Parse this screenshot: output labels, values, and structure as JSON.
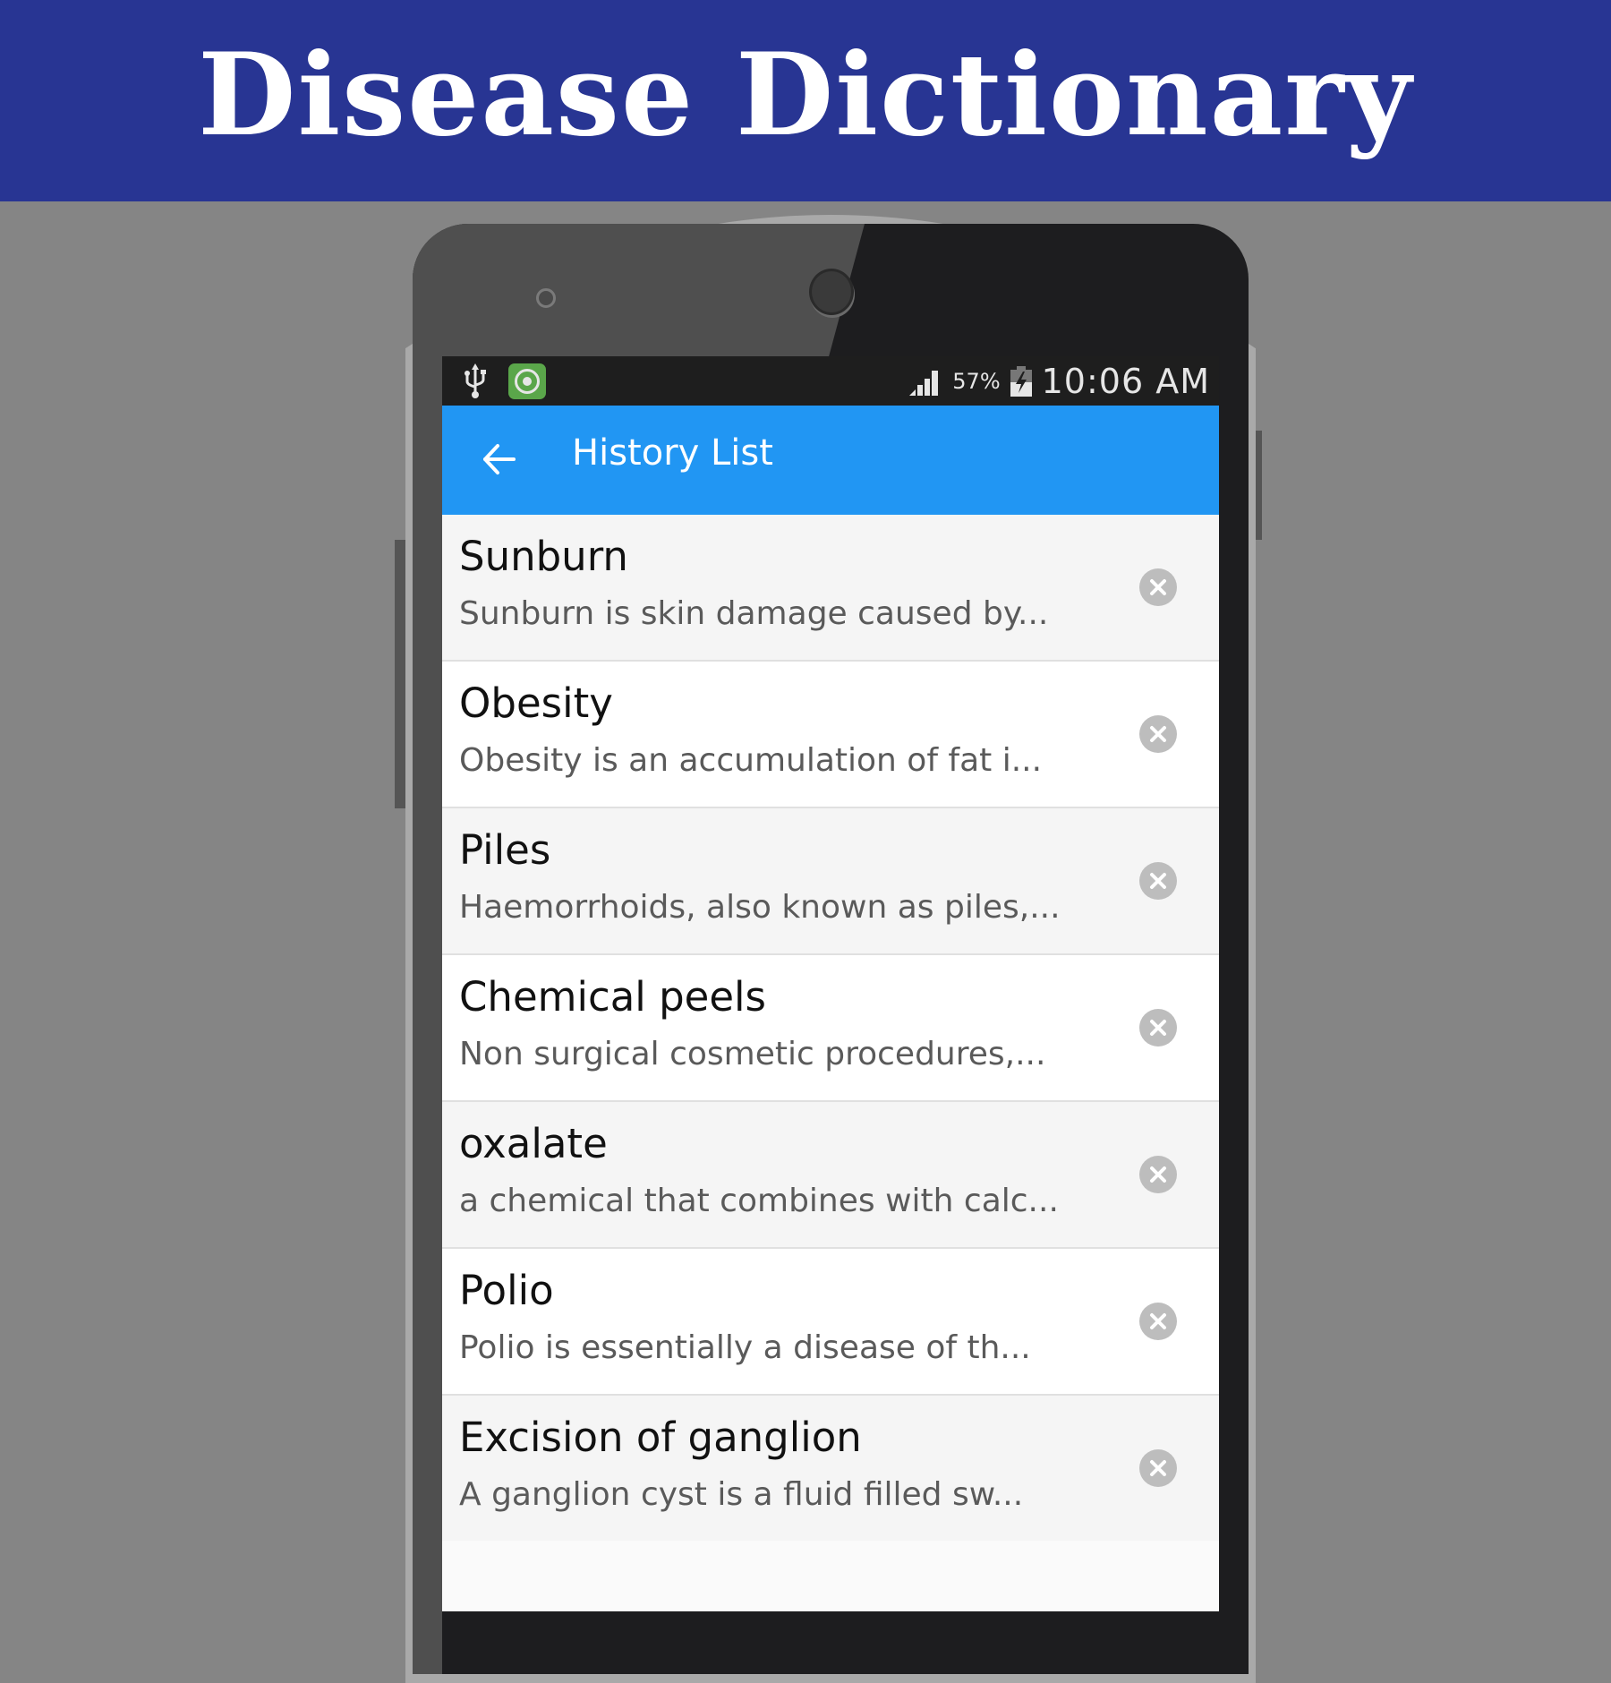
{
  "banner": {
    "title": "Disease Dictionary"
  },
  "colors": {
    "banner": "#283593",
    "app_bar": "#2196F3",
    "status_bar": "#1E1E1E",
    "row_light": "#F5F5F5",
    "row_white": "#FFFFFF",
    "delete_icon": "#BDBDBD"
  },
  "status_bar": {
    "left_icons": [
      "usb-icon",
      "app-notification-icon"
    ],
    "signal_icon": "signal-strength-icon",
    "battery_percent": "57%",
    "battery_icon": "battery-charging-icon",
    "time": "10:06 AM"
  },
  "app_bar": {
    "back_icon": "arrow-back-icon",
    "title": "History List"
  },
  "history": {
    "items": [
      {
        "title": "Sunburn",
        "description": "Sunburn is skin damage caused by...",
        "action_icon": "remove-circle-icon"
      },
      {
        "title": "Obesity",
        "description": "Obesity is an accumulation of fat i...",
        "action_icon": "remove-circle-icon"
      },
      {
        "title": "Piles",
        "description": "Haemorrhoids, also known as piles,...",
        "action_icon": "remove-circle-icon"
      },
      {
        "title": "Chemical peels",
        "description": "Non surgical cosmetic procedures,...",
        "action_icon": "remove-circle-icon"
      },
      {
        "title": "oxalate",
        "description": "a chemical that combines with calc...",
        "action_icon": "remove-circle-icon"
      },
      {
        "title": "Polio",
        "description": "Polio is essentially a disease of th...",
        "action_icon": "remove-circle-icon"
      },
      {
        "title": "Excision of ganglion",
        "description": "A ganglion cyst is a fluid filled sw...",
        "action_icon": "remove-circle-icon"
      }
    ]
  }
}
